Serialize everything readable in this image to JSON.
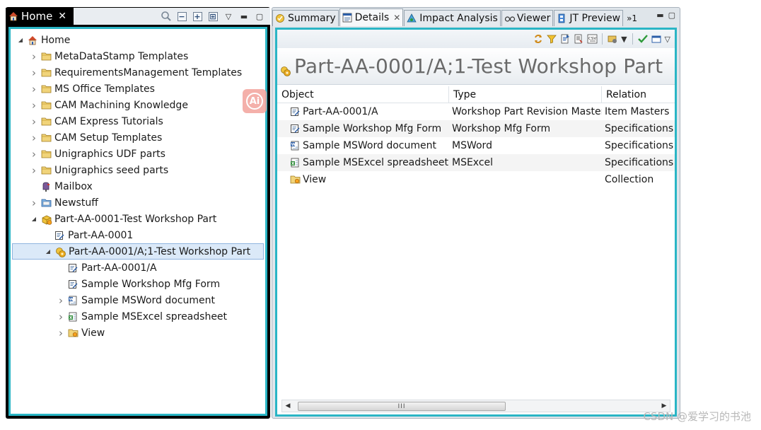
{
  "left_panel": {
    "tab_label": "Home",
    "tree": [
      {
        "label": "Home",
        "icon": "home-icon",
        "depth": 0,
        "expander": "expanded"
      },
      {
        "label": "MetaDataStamp Templates",
        "icon": "folder-icon",
        "depth": 1,
        "expander": "collapsed"
      },
      {
        "label": "RequirementsManagement Templates",
        "icon": "folder-icon",
        "depth": 1,
        "expander": "collapsed"
      },
      {
        "label": "MS Office Templates",
        "icon": "folder-icon",
        "depth": 1,
        "expander": "collapsed"
      },
      {
        "label": "CAM Machining Knowledge",
        "icon": "folder-icon",
        "depth": 1,
        "expander": "collapsed"
      },
      {
        "label": "CAM Express Tutorials",
        "icon": "folder-icon",
        "depth": 1,
        "expander": "collapsed"
      },
      {
        "label": "CAM Setup Templates",
        "icon": "folder-icon",
        "depth": 1,
        "expander": "collapsed"
      },
      {
        "label": "Unigraphics UDF parts",
        "icon": "folder-icon",
        "depth": 1,
        "expander": "collapsed"
      },
      {
        "label": "Unigraphics seed parts",
        "icon": "folder-icon",
        "depth": 1,
        "expander": "collapsed"
      },
      {
        "label": "Mailbox",
        "icon": "mailbox-icon",
        "depth": 1,
        "expander": "none"
      },
      {
        "label": "Newstuff",
        "icon": "newstuff-folder-icon",
        "depth": 1,
        "expander": "collapsed"
      },
      {
        "label": "Part-AA-0001-Test Workshop Part",
        "icon": "item-icon",
        "depth": 1,
        "expander": "expanded"
      },
      {
        "label": "Part-AA-0001",
        "icon": "form-icon",
        "depth": 2,
        "expander": "none"
      },
      {
        "label": "Part-AA-0001/A;1-Test Workshop Part",
        "icon": "item-revision-icon",
        "depth": 2,
        "expander": "expanded",
        "selected": true
      },
      {
        "label": "Part-AA-0001/A",
        "icon": "form-icon",
        "depth": 3,
        "expander": "none"
      },
      {
        "label": "Sample Workshop Mfg Form",
        "icon": "form-icon",
        "depth": 3,
        "expander": "none"
      },
      {
        "label": "Sample MSWord document",
        "icon": "msword-icon",
        "depth": 3,
        "expander": "collapsed"
      },
      {
        "label": "Sample MSExcel spreadsheet",
        "icon": "msexcel-icon",
        "depth": 3,
        "expander": "collapsed"
      },
      {
        "label": "View",
        "icon": "view-folder-icon",
        "depth": 3,
        "expander": "collapsed"
      }
    ]
  },
  "right_panel": {
    "tabs": [
      {
        "label": "Summary",
        "icon": "summary-icon",
        "active": false
      },
      {
        "label": "Details",
        "icon": "details-icon",
        "active": true
      },
      {
        "label": "Impact Analysis",
        "icon": "impact-analysis-icon",
        "active": false
      },
      {
        "label": "Viewer",
        "icon": "viewer-icon",
        "active": false
      },
      {
        "label": "JT Preview",
        "icon": "jt-preview-icon",
        "active": false
      }
    ],
    "more_tabs_label": "»1",
    "title": "Part-AA-0001/A;1-Test Workshop Part",
    "columns": [
      "Object",
      "Type",
      "Relation"
    ],
    "rows": [
      {
        "object": "Part-AA-0001/A",
        "type": "Workshop Part Revision Master",
        "relation": "Item Masters",
        "icon": "form-icon"
      },
      {
        "object": "Sample Workshop Mfg Form",
        "type": "Workshop Mfg Form",
        "relation": "Specifications",
        "icon": "form-icon"
      },
      {
        "object": "Sample MSWord document",
        "type": "MSWord",
        "relation": "Specifications",
        "icon": "msword-icon"
      },
      {
        "object": "Sample MSExcel spreadsheet",
        "type": "MSExcel",
        "relation": "Specifications",
        "icon": "msexcel-icon"
      },
      {
        "object": "View",
        "type": "",
        "relation": "Collection",
        "icon": "view-folder-icon"
      }
    ],
    "scroll_grip": "III"
  },
  "watermark": "CSDN @爱学习的书池",
  "colors": {
    "accent_border": "#2ab5c5",
    "selection": "#dbe9f8",
    "folder": "#e8c25a"
  }
}
